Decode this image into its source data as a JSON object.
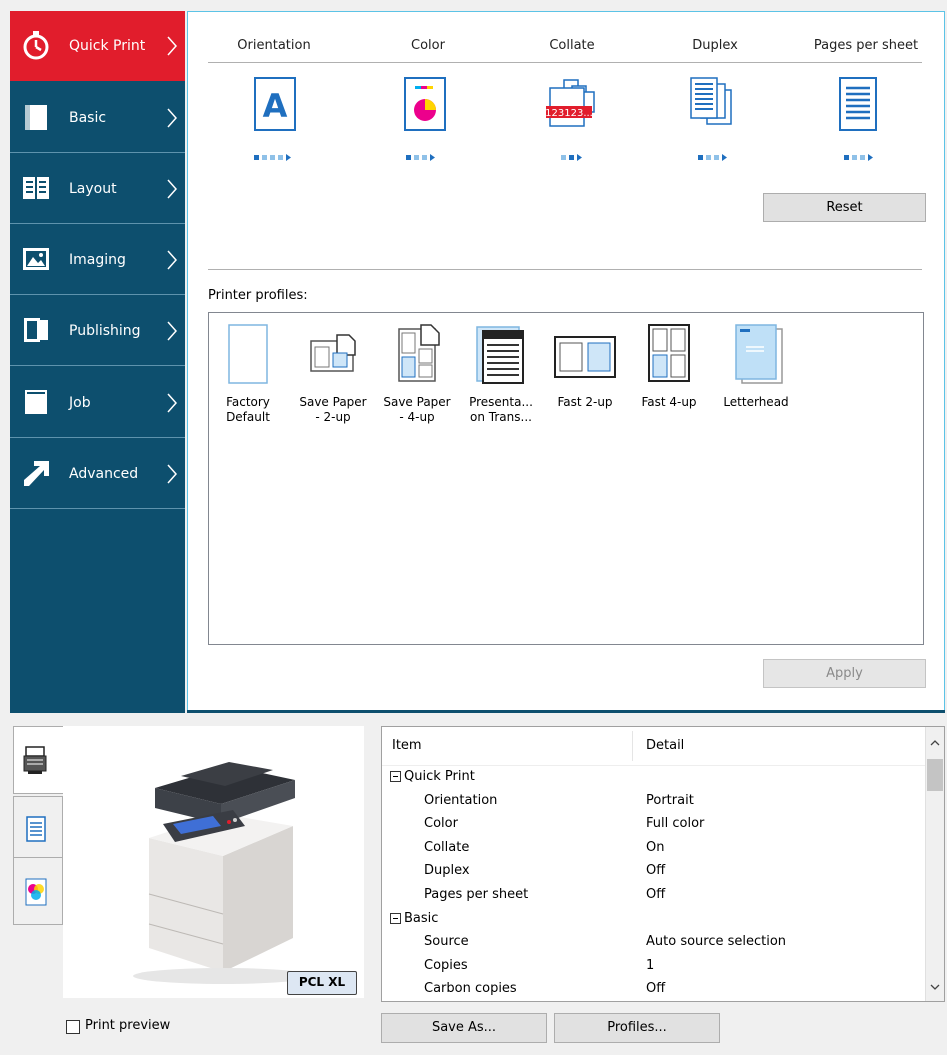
{
  "sidebar": {
    "items": [
      {
        "label": "Quick Print",
        "icon": "stopwatch-icon",
        "active": true
      },
      {
        "label": "Basic",
        "icon": "page-icon"
      },
      {
        "label": "Layout",
        "icon": "layout-icon"
      },
      {
        "label": "Imaging",
        "icon": "image-icon"
      },
      {
        "label": "Publishing",
        "icon": "publishing-icon"
      },
      {
        "label": "Job",
        "icon": "job-icon"
      },
      {
        "label": "Advanced",
        "icon": "arrow-icon"
      }
    ]
  },
  "quick_print": {
    "headers": [
      "Orientation",
      "Color",
      "Collate",
      "Duplex",
      "Pages per sheet"
    ],
    "orientation_letter": "A",
    "collate_text": "123123...",
    "reset_label": "Reset"
  },
  "profiles": {
    "label": "Printer profiles:",
    "items": [
      {
        "label": "Factory\nDefault",
        "icon": "blank-page-icon"
      },
      {
        "label": "Save Paper\n- 2-up",
        "icon": "two-up-icon"
      },
      {
        "label": "Save Paper\n- 4-up",
        "icon": "four-up-icon"
      },
      {
        "label": "Presenta...\non Trans...",
        "icon": "presentation-icon"
      },
      {
        "label": "Fast 2-up",
        "icon": "fast-two-up-icon"
      },
      {
        "label": "Fast 4-up",
        "icon": "fast-four-up-icon"
      },
      {
        "label": "Letterhead",
        "icon": "letterhead-icon"
      }
    ],
    "apply_label": "Apply"
  },
  "preview": {
    "badge": "PCL XL",
    "print_preview_label": "Print preview",
    "print_preview_checked": false
  },
  "summary": {
    "col_item": "Item",
    "col_detail": "Detail",
    "rows": [
      {
        "group": true,
        "item": "Quick Print",
        "detail": ""
      },
      {
        "group": false,
        "item": "Orientation",
        "detail": "Portrait"
      },
      {
        "group": false,
        "item": "Color",
        "detail": "Full color"
      },
      {
        "group": false,
        "item": "Collate",
        "detail": "On"
      },
      {
        "group": false,
        "item": "Duplex",
        "detail": "Off"
      },
      {
        "group": false,
        "item": "Pages per sheet",
        "detail": "Off"
      },
      {
        "group": true,
        "item": "Basic",
        "detail": ""
      },
      {
        "group": false,
        "item": "Source",
        "detail": "Auto source selection"
      },
      {
        "group": false,
        "item": "Copies",
        "detail": "1"
      },
      {
        "group": false,
        "item": "Carbon copies",
        "detail": "Off"
      }
    ]
  },
  "footer": {
    "save_as_label": "Save As...",
    "profiles_label": "Profiles..."
  },
  "colors": {
    "nav_bg": "#0d4f6e",
    "nav_active": "#e11d2c",
    "accent": "#1f6fbf"
  }
}
